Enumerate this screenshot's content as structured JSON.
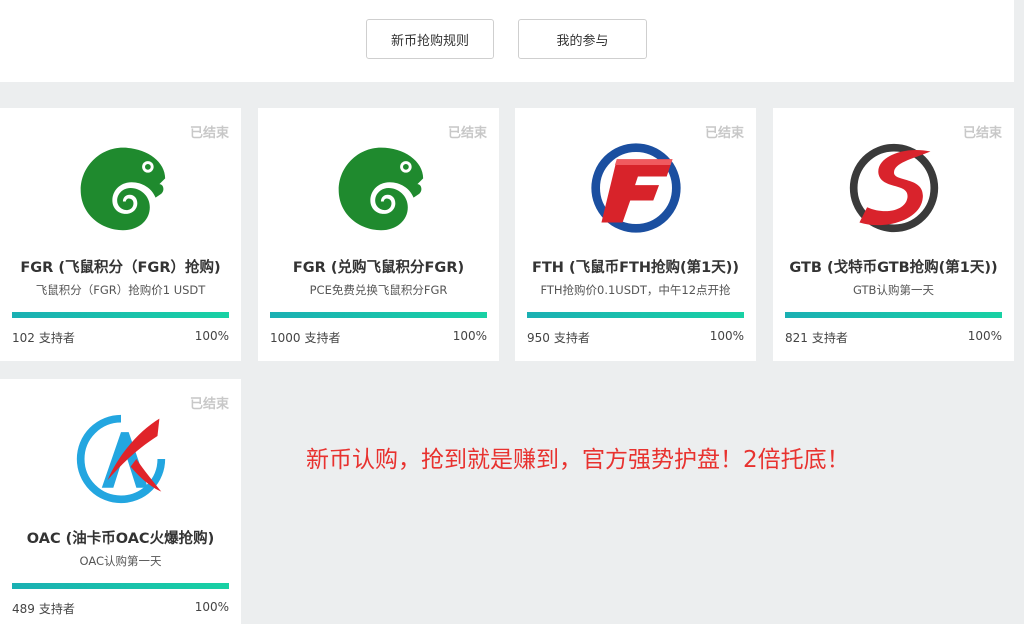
{
  "header": {
    "rules_button": "新币抢购规则",
    "my_participation_button": "我的参与"
  },
  "cards": [
    {
      "status": "已结束",
      "title": "FGR (飞鼠积分（FGR）抢购)",
      "subtitle": "飞鼠积分（FGR）抢购价1 USDT",
      "supporters_count": "102",
      "supporters_label": "支持者",
      "progress_label": "100%",
      "progress": 1.0,
      "logo": "chameleon-logo-icon"
    },
    {
      "status": "已结束",
      "title": "FGR (兑购飞鼠积分FGR)",
      "subtitle": "PCE免费兑换飞鼠积分FGR",
      "supporters_count": "1000",
      "supporters_label": "支持者",
      "progress_label": "100%",
      "progress": 1.0,
      "logo": "chameleon-logo-icon"
    },
    {
      "status": "已结束",
      "title": "FTH (飞鼠币FTH抢购(第1天))",
      "subtitle": "FTH抢购价0.1USDT，中午12点开抢",
      "supporters_count": "950",
      "supporters_label": "支持者",
      "progress_label": "100%",
      "progress": 1.0,
      "logo": "fth-logo-icon"
    },
    {
      "status": "已结束",
      "title": "GTB (戈特币GTB抢购(第1天))",
      "subtitle": "GTB认购第一天",
      "supporters_count": "821",
      "supporters_label": "支持者",
      "progress_label": "100%",
      "progress": 1.0,
      "logo": "gtb-logo-icon"
    },
    {
      "status": "已结束",
      "title": "OAC (油卡币OAC火爆抢购)",
      "subtitle": "OAC认购第一天",
      "supporters_count": "489",
      "supporters_label": "支持者",
      "progress_label": "100%",
      "progress": 1.0,
      "logo": "oac-logo-icon"
    }
  ],
  "promo_text": "新币认购，抢到就是赚到，官方强势护盘！2倍托底！",
  "colors": {
    "status_grey": "#c8c8c8",
    "progress_start": "#1ab0b3",
    "progress_end": "#18d1a4",
    "promo_red": "#e8322f",
    "chameleon_green": "#1f8a2e",
    "fth_blue": "#1b4fa0",
    "fth_red": "#d8232a",
    "gtb_red": "#d9232c",
    "gtb_dark": "#3a3a3a",
    "oac_blue": "#23a6e0",
    "oac_red": "#e0242a"
  }
}
